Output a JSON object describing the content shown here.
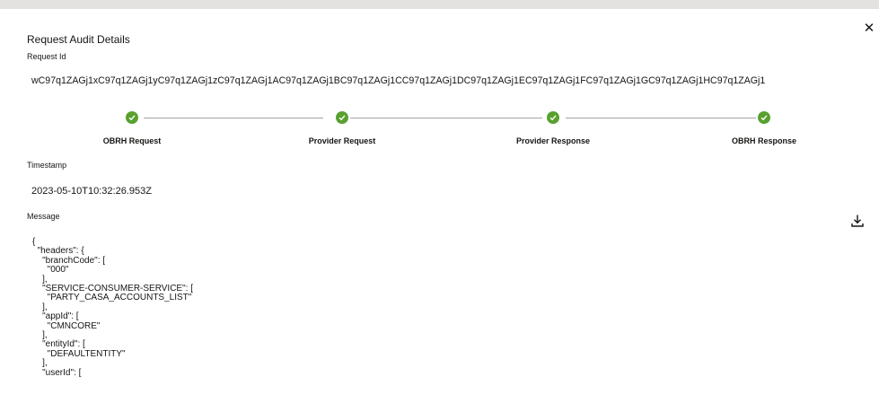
{
  "dialog": {
    "title": "Request Audit Details",
    "close_icon": "close-icon"
  },
  "request_id": {
    "label": "Request Id",
    "value": "wC97q1ZAGj1xC97q1ZAGj1yC97q1ZAGj1zC97q1ZAGj1AC97q1ZAGj1BC97q1ZAGj1CC97q1ZAGj1DC97q1ZAGj1EC97q1ZAGj1FC97q1ZAGj1GC97q1ZAGj1HC97q1ZAGj1"
  },
  "progress": {
    "status_color": "#58a02f",
    "steps": [
      {
        "label": "OBRH Request",
        "status": "complete"
      },
      {
        "label": "Provider Request",
        "status": "complete"
      },
      {
        "label": "Provider Response",
        "status": "complete"
      },
      {
        "label": "OBRH Response",
        "status": "complete"
      }
    ]
  },
  "timestamp": {
    "label": "Timestamp",
    "value": "2023-05-10T10:32:26.953Z"
  },
  "message": {
    "label": "Message",
    "download_icon": "download-icon",
    "body": "{\n  \"headers\": {\n    \"branchCode\": [\n      \"000\"\n    ],\n    \"SERVICE-CONSUMER-SERVICE\": [\n      \"PARTY_CASA_ACCOUNTS_LIST\"\n    ],\n    \"appId\": [\n      \"CMNCORE\"\n    ],\n    \"entityId\": [\n      \"DEFAULTENTITY\"\n    ],\n    \"userId\": ["
  }
}
